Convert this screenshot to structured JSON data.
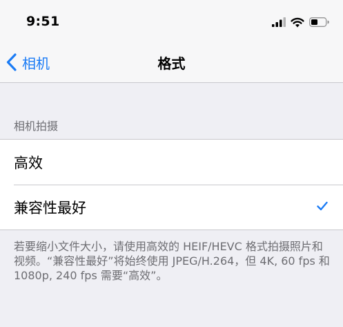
{
  "status_bar": {
    "time": "9:51",
    "icons": [
      "cellular-signal-icon",
      "wifi-icon",
      "battery-icon"
    ]
  },
  "nav": {
    "back_label": "相机",
    "title": "格式"
  },
  "section": {
    "header": "相机拍摄",
    "options": [
      {
        "label": "高效",
        "selected": false
      },
      {
        "label": "兼容性最好",
        "selected": true
      }
    ]
  },
  "footer": {
    "note": "若要缩小文件大小，请使用高效的 HEIF/HEVC 格式拍摄照片和视频。“兼容性最好”将始终使用 JPEG/H.264，但 4K, 60 fps 和 1080p, 240 fps 需要“高效”。"
  },
  "colors": {
    "accent": "#1a7bf5",
    "background": "#efeff4",
    "secondary_text": "#6d6d72",
    "separator": "#c8c7cc"
  }
}
